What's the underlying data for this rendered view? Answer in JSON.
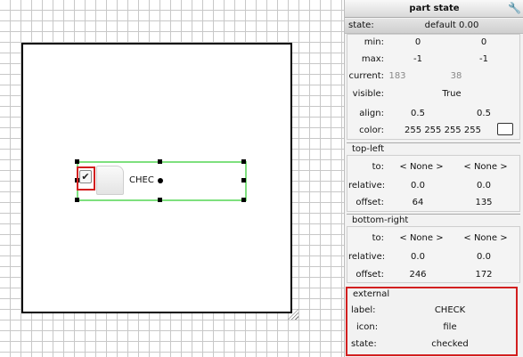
{
  "canvas": {
    "part_label": "CHEC",
    "check_glyph": "✔"
  },
  "panel": {
    "title": "part state",
    "state_label": "state:",
    "state_value": "default 0.00",
    "min": {
      "label": "min:",
      "x": "0",
      "y": "0"
    },
    "max": {
      "label": "max:",
      "x": "-1",
      "y": "-1"
    },
    "current": {
      "label": "current:",
      "x": "183",
      "y": "38"
    },
    "visible": {
      "label": "visible:",
      "value": "True"
    },
    "align": {
      "label": "align:",
      "x": "0.5",
      "y": "0.5"
    },
    "color": {
      "label": "color:",
      "value": "255 255 255 255",
      "swatch": "#ffffff"
    },
    "top_left": {
      "header": "top-left",
      "to": {
        "label": "to:",
        "x": "< None >",
        "y": "< None >"
      },
      "relative": {
        "label": "relative:",
        "x": "0.0",
        "y": "0.0"
      },
      "offset": {
        "label": "offset:",
        "x": "64",
        "y": "135"
      }
    },
    "bottom_right": {
      "header": "bottom-right",
      "to": {
        "label": "to:",
        "x": "< None >",
        "y": "< None >"
      },
      "relative": {
        "label": "relative:",
        "x": "0.0",
        "y": "0.0"
      },
      "offset": {
        "label": "offset:",
        "x": "246",
        "y": "172"
      }
    },
    "external": {
      "header": "external",
      "label": {
        "label": "label:",
        "value": "CHECK"
      },
      "icon": {
        "label": "icon:",
        "value": "file"
      },
      "state": {
        "label": "state:",
        "value": "checked"
      }
    }
  },
  "colors": {
    "selection_border": "#7ee07e",
    "highlight_red": "#d21f1f"
  },
  "icons": {
    "panel_tool": "wrench-icon",
    "part_icon": "file-icon",
    "check": "checkmark-icon"
  }
}
